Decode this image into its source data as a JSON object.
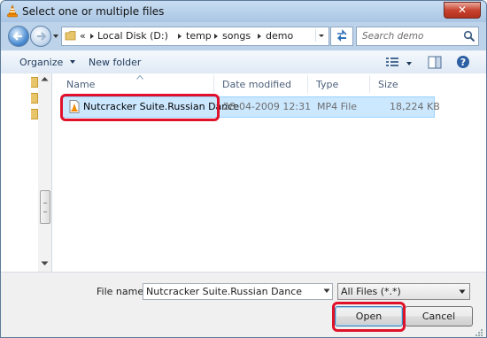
{
  "window": {
    "title": "Select one or multiple files",
    "close_glyph": "✕"
  },
  "breadcrumb": {
    "overflow": "«",
    "crumbs": [
      "Local Disk (D:)",
      "temp",
      "songs",
      "demo"
    ]
  },
  "search": {
    "placeholder": "Search demo"
  },
  "toolbar": {
    "organize": "Organize",
    "new_folder": "New folder"
  },
  "columns": {
    "name": "Name",
    "date": "Date modified",
    "type": "Type",
    "size": "Size"
  },
  "files": [
    {
      "name": "Nutcracker Suite.Russian Dance",
      "date": "28-04-2009 12:31",
      "type": "MP4 File",
      "size": "18,224 KB"
    }
  ],
  "bottom": {
    "file_name_label": "File name:",
    "file_name_value": "Nutcracker Suite.Russian Dance",
    "file_type": "All Files (*.*)",
    "open": "Open",
    "cancel": "Cancel"
  },
  "colors": {
    "highlight": "#e0122a",
    "selection": "#cce8ff",
    "accent": "#3c7fb1"
  }
}
